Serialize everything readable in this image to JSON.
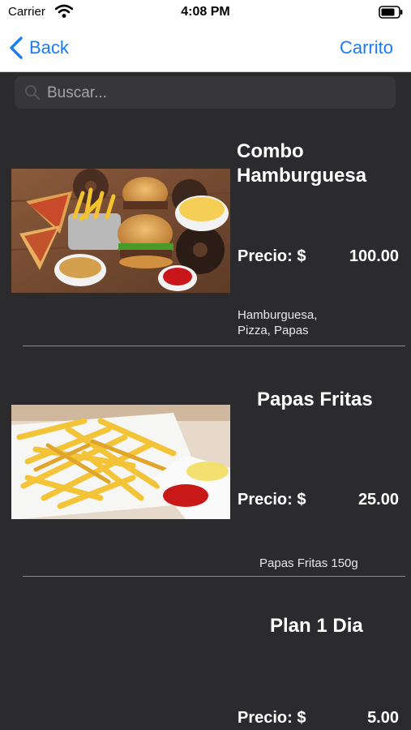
{
  "status_bar": {
    "carrier": "Carrier",
    "time": "4:08 PM"
  },
  "nav": {
    "back_label": "Back",
    "cart_label": "Carrito",
    "accent_color": "#1a7cf4"
  },
  "search": {
    "placeholder": "Buscar...",
    "value": ""
  },
  "products": [
    {
      "title_line1": "Combo",
      "title_line2": "Hamburguesa",
      "price_label": "Precio: $",
      "price": "100.00",
      "desc_line1": "Hamburguesa,",
      "desc_line2": "Pizza, Papas",
      "image": "burger-combo-photo"
    },
    {
      "title": "Papas Fritas",
      "price_label": "Precio: $",
      "price": "25.00",
      "desc": "Papas Fritas 150g",
      "image": "french-fries-photo"
    },
    {
      "title": "Plan 1 Dia",
      "price_label": "Precio: $",
      "price": "5.00"
    }
  ],
  "colors": {
    "background": "#2b2b2d",
    "search_bg": "#37373a",
    "divider": "#8c8c8e"
  }
}
